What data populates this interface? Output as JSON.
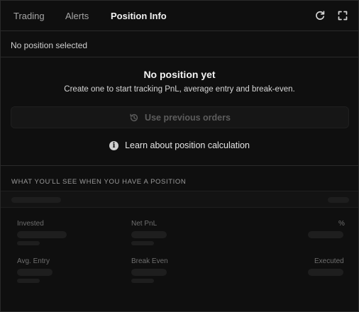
{
  "tabs": [
    {
      "label": "Trading"
    },
    {
      "label": "Alerts"
    },
    {
      "label": "Position Info"
    }
  ],
  "header_icons": [
    "refresh-icon",
    "expand-icon"
  ],
  "selection": {
    "text": "No position selected"
  },
  "empty_state": {
    "title": "No position yet",
    "subtitle": "Create one to start tracking PnL, average entry and break-even.",
    "button_label": "Use previous orders",
    "button_icon": "history-icon",
    "learn_label": "Learn about position calculation",
    "learn_icon": "info-icon"
  },
  "preview": {
    "heading": "WHAT YOU'LL SEE WHEN YOU HAVE A POSITION",
    "stats": [
      {
        "label": "Invested"
      },
      {
        "label": "Net PnL"
      },
      {
        "label": "%"
      },
      {
        "label": "Avg. Entry"
      },
      {
        "label": "Break Even"
      },
      {
        "label": "Executed"
      }
    ]
  },
  "colors": {
    "background": "#0f0f0f",
    "border": "#2a2a2a",
    "active_text": "#f2f2f2",
    "muted_text": "#a6a6a6",
    "skeleton": "#1e1e1e"
  }
}
